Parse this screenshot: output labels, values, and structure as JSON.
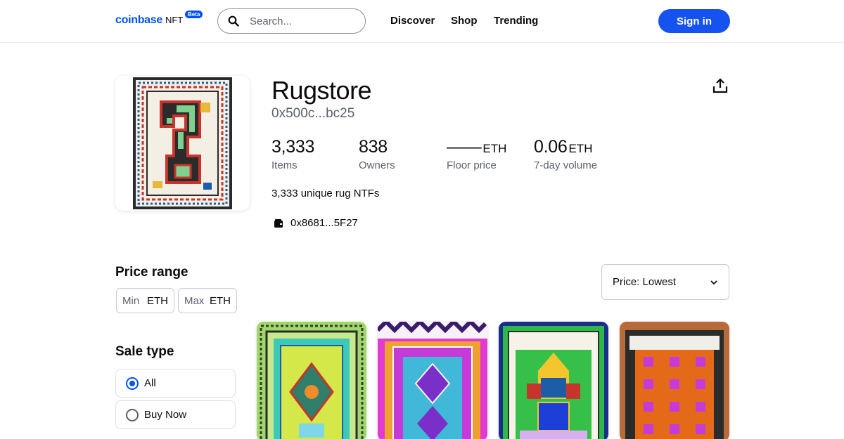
{
  "header": {
    "logo_word": "coinbase",
    "logo_nft": "NFT",
    "beta_badge": "Beta",
    "search_placeholder": "Search...",
    "nav": [
      "Discover",
      "Shop",
      "Trending"
    ],
    "signin_label": "Sign in",
    "accent_color": "#0052ff"
  },
  "collection": {
    "name": "Rugstore",
    "contract_address": "0x500c...bc25",
    "stats": [
      {
        "value": "3,333",
        "unit": "",
        "label": "Items"
      },
      {
        "value": "838",
        "unit": "",
        "label": "Owners"
      },
      {
        "value": "——",
        "unit": "ETH",
        "label": "Floor price"
      },
      {
        "value": "0.06",
        "unit": "ETH",
        "label": "7-day volume"
      }
    ],
    "description": "3,333 unique rug NTFs",
    "owner_address": "0x8681...5F27"
  },
  "filters": {
    "price_range_title": "Price range",
    "min_placeholder": "Min",
    "max_placeholder": "Max",
    "unit": "ETH",
    "sale_type_title": "Sale type",
    "sale_options": [
      {
        "label": "All",
        "selected": true
      },
      {
        "label": "Buy Now",
        "selected": false
      }
    ]
  },
  "sort": {
    "selected": "Price: Lowest"
  },
  "icons": {
    "search": "search-icon",
    "share": "share-icon",
    "wallet": "wallet-icon",
    "chevron": "chevron-down-icon"
  }
}
